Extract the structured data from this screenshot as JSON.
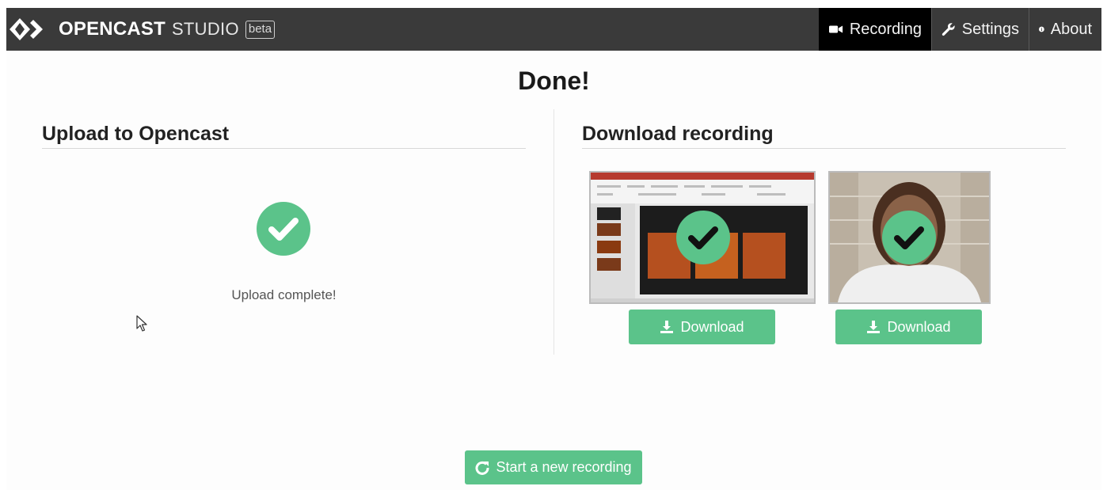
{
  "header": {
    "brand": "OPENCAST",
    "studio": "STUDIO",
    "beta": "beta",
    "nav": [
      {
        "label": "Recording",
        "icon": "video-camera-icon",
        "active": true
      },
      {
        "label": "Settings",
        "icon": "wrench-icon",
        "active": false
      },
      {
        "label": "About",
        "icon": "info-icon",
        "active": false
      }
    ]
  },
  "main": {
    "title": "Done!",
    "upload": {
      "heading": "Upload to Opencast",
      "icon": "check-circle-icon",
      "status": "Upload complete!"
    },
    "download": {
      "heading": "Download recording",
      "items": [
        {
          "kind": "screen-recording",
          "button_label": "Download",
          "icon": "download-icon"
        },
        {
          "kind": "camera-recording",
          "button_label": "Download",
          "icon": "download-icon"
        }
      ]
    },
    "new_recording_label": "Start a new recording"
  },
  "colors": {
    "header_bg": "#3a3a3a",
    "nav_active_bg": "#000000",
    "accent_green": "#5bc38a"
  }
}
